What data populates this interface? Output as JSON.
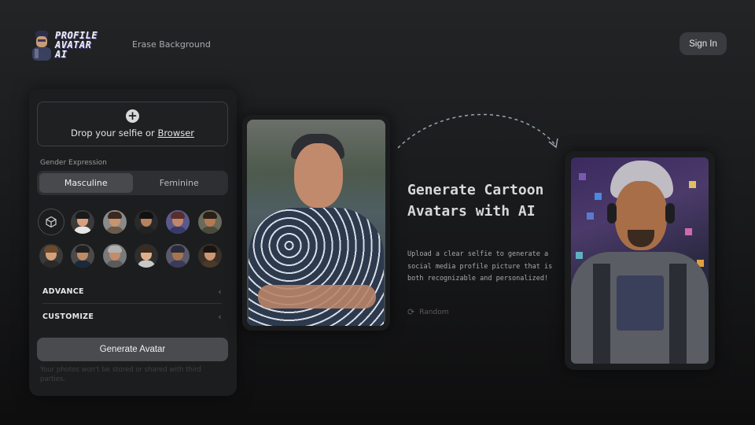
{
  "header": {
    "logo_line1": "PROFILE",
    "logo_line2": "AVATAR AI",
    "nav_erase": "Erase Background",
    "signin_label": "Sign In"
  },
  "panel": {
    "drop_text": "Drop your selfie or ",
    "drop_link": "Browser",
    "gender_label": "Gender Expression",
    "gender_options": [
      "Masculine",
      "Feminine"
    ],
    "gender_selected": "Masculine",
    "advance_label": "ADVANCE",
    "customize_label": "CUSTOMIZE",
    "generate_label": "Generate Avatar",
    "privacy_text": "Your photos won't be stored or shared with third parties."
  },
  "avatars": {
    "row1": [
      {
        "hair": "#1a1a1a",
        "skin": "#d9a07f",
        "body": "#e6e6e6",
        "bg": "#3a3a3a"
      },
      {
        "hair": "#3a2a1e",
        "skin": "#c8946e",
        "body": "#6a5a4a",
        "bg": "#8a8a8a"
      },
      {
        "hair": "#111111",
        "skin": "#b7825e",
        "body": "#222222",
        "bg": "#2a2a2a"
      },
      {
        "hair": "#5a2e2e",
        "skin": "#c0876a",
        "body": "#3a3a6a",
        "bg": "#5a5a8a"
      },
      {
        "hair": "#2a2018",
        "skin": "#b37a54",
        "body": "#4a4a3a",
        "bg": "#6a6a5a"
      }
    ],
    "row2": [
      {
        "hair": "#6a4a2a",
        "skin": "#d4a07c",
        "body": "#2a2a2a",
        "bg": "#3a3a3a"
      },
      {
        "hair": "#202020",
        "skin": "#bf8a66",
        "body": "#1a2a3a",
        "bg": "#4a4a4a"
      },
      {
        "hair": "#b0b0b0",
        "skin": "#c48c6a",
        "body": "#5a5a5a",
        "bg": "#7a7a7a"
      },
      {
        "hair": "#3a2a20",
        "skin": "#e0ae8c",
        "body": "#c8c8c8",
        "bg": "#2e2e2e"
      },
      {
        "hair": "#2a2a3a",
        "skin": "#a8744e",
        "body": "#3a3a5a",
        "bg": "#5a5a6a"
      },
      {
        "hair": "#1a1410",
        "skin": "#cc9874",
        "body": "#4a3a2a",
        "bg": "#3a3028"
      }
    ]
  },
  "hero": {
    "title": "Generate Cartoon Avatars with AI",
    "description": "Upload a clear selfie to generate a social media profile picture that is both recognizable and personalized!",
    "random_label": "Random"
  },
  "colors": {
    "background": "#1b1c1e",
    "panel": "#1c1d1f",
    "button": "#4a4b4f",
    "accent_dashed": "#9aa3ad"
  },
  "icons": [
    "plus-icon",
    "cube-icon",
    "chevron-left-icon",
    "refresh-icon",
    "dashed-arrow-icon"
  ]
}
